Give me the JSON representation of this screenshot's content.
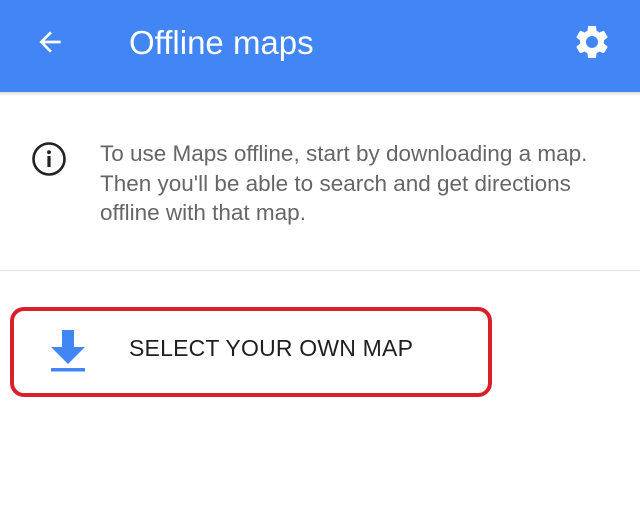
{
  "app_bar": {
    "title": "Offline maps",
    "back_icon": "arrow-back-icon",
    "settings_icon": "gear-icon",
    "color": "#4285f4"
  },
  "info": {
    "icon": "info-icon",
    "text": "To use Maps offline, start by downloading a map. Then you'll be able to search and get directions offline with that map."
  },
  "action": {
    "icon": "download-icon",
    "label": "SELECT YOUR OWN MAP",
    "icon_color": "#4285f4",
    "highlight_color": "#d9202a"
  }
}
